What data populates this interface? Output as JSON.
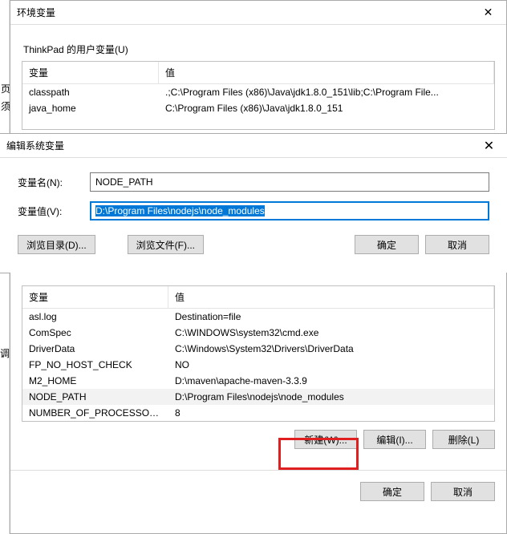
{
  "back_window": {
    "title": "环境变量",
    "user_var_group": "ThinkPad 的用户变量(U)",
    "col_var": "变量",
    "col_val": "值",
    "rows": [
      {
        "name": "classpath",
        "value": ".;C:\\Program Files (x86)\\Java\\jdk1.8.0_151\\lib;C:\\Program File..."
      },
      {
        "name": "java_home",
        "value": "C:\\Program Files (x86)\\Java\\jdk1.8.0_151"
      }
    ]
  },
  "edit_dialog": {
    "title": "编辑系统变量",
    "name_label": "变量名(N):",
    "name_value": "NODE_PATH",
    "value_label": "变量值(V):",
    "value_value": "D:\\Program Files\\nodejs\\node_modules",
    "browse_dir": "浏览目录(D)...",
    "browse_file": "浏览文件(F)...",
    "ok": "确定",
    "cancel": "取消"
  },
  "sys_panel": {
    "col_var": "变量",
    "col_val": "值",
    "rows": [
      {
        "name": "asl.log",
        "value": "Destination=file"
      },
      {
        "name": "ComSpec",
        "value": "C:\\WINDOWS\\system32\\cmd.exe"
      },
      {
        "name": "DriverData",
        "value": "C:\\Windows\\System32\\Drivers\\DriverData"
      },
      {
        "name": "FP_NO_HOST_CHECK",
        "value": "NO"
      },
      {
        "name": "M2_HOME",
        "value": "D:\\maven\\apache-maven-3.3.9"
      },
      {
        "name": "NODE_PATH",
        "value": "D:\\Program Files\\nodejs\\node_modules",
        "selected": true
      },
      {
        "name": "NUMBER_OF_PROCESSORS",
        "value": "8"
      }
    ],
    "new_btn": "新建(W)...",
    "edit_btn": "编辑(I)...",
    "delete_btn": "删除(L)",
    "ok": "确定",
    "cancel": "取消"
  },
  "left_marks": {
    "a": "页",
    "b": "须",
    "c": "调"
  }
}
